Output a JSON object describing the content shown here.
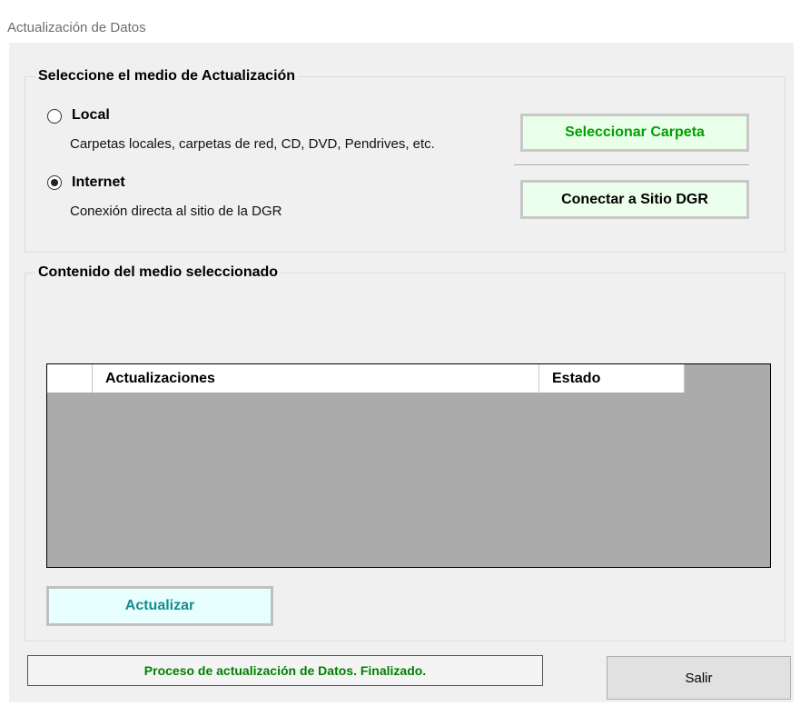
{
  "window": {
    "title": "Actualización de Datos"
  },
  "medio": {
    "title": "Seleccione el medio de Actualización",
    "options": [
      {
        "label": "Local",
        "description": "Carpetas locales, carpetas de red, CD, DVD, Pendrives, etc.",
        "checked": false
      },
      {
        "label": "Internet",
        "description": "Conexión directa al sitio de la DGR",
        "checked": true
      }
    ],
    "select_folder_label": "Seleccionar Carpeta",
    "connect_label": "Conectar a Sitio DGR"
  },
  "contenido": {
    "title": "Contenido del medio seleccionado",
    "columns": [
      "Actualizaciones",
      "Estado"
    ],
    "rows": [],
    "update_label": "Actualizar"
  },
  "status": {
    "text": "Proceso de actualización de Datos. Finalizado."
  },
  "exit_label": "Salir",
  "colors": {
    "select_folder_text": "#00a000",
    "update_text": "#148c8c",
    "status_text": "#008000",
    "grid_background": "#ababab"
  }
}
